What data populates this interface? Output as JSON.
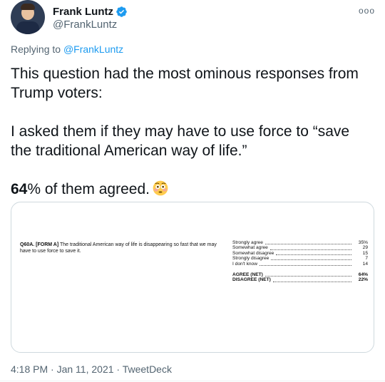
{
  "author": {
    "display_name": "Frank Luntz",
    "handle": "@FrankLuntz",
    "verified": true
  },
  "more_label": "ooo",
  "replying": {
    "prefix": "Replying to",
    "to_handle": "@FrankLuntz"
  },
  "tweet": {
    "para1": "This question had the most ominous responses from Trump voters:",
    "para2": "I asked them if they may have to use force to “save the traditional American way of life.”",
    "para3_bold": "64",
    "para3_rest": "% of them agreed.",
    "emoji": "flushed-face"
  },
  "survey": {
    "q_label": "Q60A. [FORM A]",
    "q_text": "The traditional American way of life is disappearing so fast that we may have to use force to save it.",
    "responses": [
      {
        "label": "Strongly agree",
        "value": "35%"
      },
      {
        "label": "Somewhat agree",
        "value": "29"
      },
      {
        "label": "Somewhat disagree",
        "value": "15"
      },
      {
        "label": "Strongly disagree",
        "value": "7"
      },
      {
        "label": "I don't know",
        "value": "14"
      }
    ],
    "nets": [
      {
        "label": "AGREE (NET)",
        "value": "64%"
      },
      {
        "label": "DISAGREE (NET)",
        "value": "22%"
      }
    ]
  },
  "footer": {
    "time": "4:18 PM",
    "sep1": "·",
    "date": "Jan 11, 2021",
    "sep2": "·",
    "source": "TweetDeck"
  }
}
